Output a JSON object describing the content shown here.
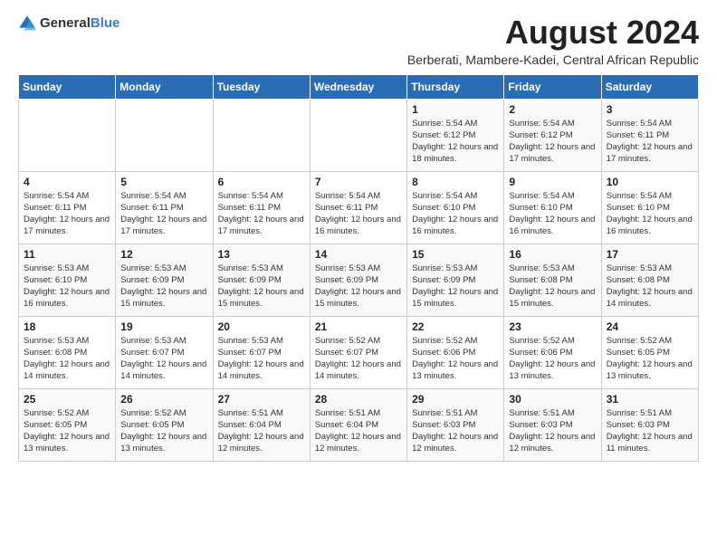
{
  "header": {
    "logo_general": "General",
    "logo_blue": "Blue",
    "title": "August 2024",
    "subtitle": "Berberati, Mambere-Kadei, Central African Republic"
  },
  "days_of_week": [
    "Sunday",
    "Monday",
    "Tuesday",
    "Wednesday",
    "Thursday",
    "Friday",
    "Saturday"
  ],
  "weeks": [
    {
      "days": [
        {
          "number": "",
          "info": ""
        },
        {
          "number": "",
          "info": ""
        },
        {
          "number": "",
          "info": ""
        },
        {
          "number": "",
          "info": ""
        },
        {
          "number": "1",
          "info": "Sunrise: 5:54 AM\nSunset: 6:12 PM\nDaylight: 12 hours and 18 minutes."
        },
        {
          "number": "2",
          "info": "Sunrise: 5:54 AM\nSunset: 6:12 PM\nDaylight: 12 hours and 17 minutes."
        },
        {
          "number": "3",
          "info": "Sunrise: 5:54 AM\nSunset: 6:11 PM\nDaylight: 12 hours and 17 minutes."
        }
      ]
    },
    {
      "days": [
        {
          "number": "4",
          "info": "Sunrise: 5:54 AM\nSunset: 6:11 PM\nDaylight: 12 hours and 17 minutes."
        },
        {
          "number": "5",
          "info": "Sunrise: 5:54 AM\nSunset: 6:11 PM\nDaylight: 12 hours and 17 minutes."
        },
        {
          "number": "6",
          "info": "Sunrise: 5:54 AM\nSunset: 6:11 PM\nDaylight: 12 hours and 17 minutes."
        },
        {
          "number": "7",
          "info": "Sunrise: 5:54 AM\nSunset: 6:11 PM\nDaylight: 12 hours and 16 minutes."
        },
        {
          "number": "8",
          "info": "Sunrise: 5:54 AM\nSunset: 6:10 PM\nDaylight: 12 hours and 16 minutes."
        },
        {
          "number": "9",
          "info": "Sunrise: 5:54 AM\nSunset: 6:10 PM\nDaylight: 12 hours and 16 minutes."
        },
        {
          "number": "10",
          "info": "Sunrise: 5:54 AM\nSunset: 6:10 PM\nDaylight: 12 hours and 16 minutes."
        }
      ]
    },
    {
      "days": [
        {
          "number": "11",
          "info": "Sunrise: 5:53 AM\nSunset: 6:10 PM\nDaylight: 12 hours and 16 minutes."
        },
        {
          "number": "12",
          "info": "Sunrise: 5:53 AM\nSunset: 6:09 PM\nDaylight: 12 hours and 15 minutes."
        },
        {
          "number": "13",
          "info": "Sunrise: 5:53 AM\nSunset: 6:09 PM\nDaylight: 12 hours and 15 minutes."
        },
        {
          "number": "14",
          "info": "Sunrise: 5:53 AM\nSunset: 6:09 PM\nDaylight: 12 hours and 15 minutes."
        },
        {
          "number": "15",
          "info": "Sunrise: 5:53 AM\nSunset: 6:09 PM\nDaylight: 12 hours and 15 minutes."
        },
        {
          "number": "16",
          "info": "Sunrise: 5:53 AM\nSunset: 6:08 PM\nDaylight: 12 hours and 15 minutes."
        },
        {
          "number": "17",
          "info": "Sunrise: 5:53 AM\nSunset: 6:08 PM\nDaylight: 12 hours and 14 minutes."
        }
      ]
    },
    {
      "days": [
        {
          "number": "18",
          "info": "Sunrise: 5:53 AM\nSunset: 6:08 PM\nDaylight: 12 hours and 14 minutes."
        },
        {
          "number": "19",
          "info": "Sunrise: 5:53 AM\nSunset: 6:07 PM\nDaylight: 12 hours and 14 minutes."
        },
        {
          "number": "20",
          "info": "Sunrise: 5:53 AM\nSunset: 6:07 PM\nDaylight: 12 hours and 14 minutes."
        },
        {
          "number": "21",
          "info": "Sunrise: 5:52 AM\nSunset: 6:07 PM\nDaylight: 12 hours and 14 minutes."
        },
        {
          "number": "22",
          "info": "Sunrise: 5:52 AM\nSunset: 6:06 PM\nDaylight: 12 hours and 13 minutes."
        },
        {
          "number": "23",
          "info": "Sunrise: 5:52 AM\nSunset: 6:06 PM\nDaylight: 12 hours and 13 minutes."
        },
        {
          "number": "24",
          "info": "Sunrise: 5:52 AM\nSunset: 6:05 PM\nDaylight: 12 hours and 13 minutes."
        }
      ]
    },
    {
      "days": [
        {
          "number": "25",
          "info": "Sunrise: 5:52 AM\nSunset: 6:05 PM\nDaylight: 12 hours and 13 minutes."
        },
        {
          "number": "26",
          "info": "Sunrise: 5:52 AM\nSunset: 6:05 PM\nDaylight: 12 hours and 13 minutes."
        },
        {
          "number": "27",
          "info": "Sunrise: 5:51 AM\nSunset: 6:04 PM\nDaylight: 12 hours and 12 minutes."
        },
        {
          "number": "28",
          "info": "Sunrise: 5:51 AM\nSunset: 6:04 PM\nDaylight: 12 hours and 12 minutes."
        },
        {
          "number": "29",
          "info": "Sunrise: 5:51 AM\nSunset: 6:03 PM\nDaylight: 12 hours and 12 minutes."
        },
        {
          "number": "30",
          "info": "Sunrise: 5:51 AM\nSunset: 6:03 PM\nDaylight: 12 hours and 12 minutes."
        },
        {
          "number": "31",
          "info": "Sunrise: 5:51 AM\nSunset: 6:03 PM\nDaylight: 12 hours and 11 minutes."
        }
      ]
    }
  ]
}
